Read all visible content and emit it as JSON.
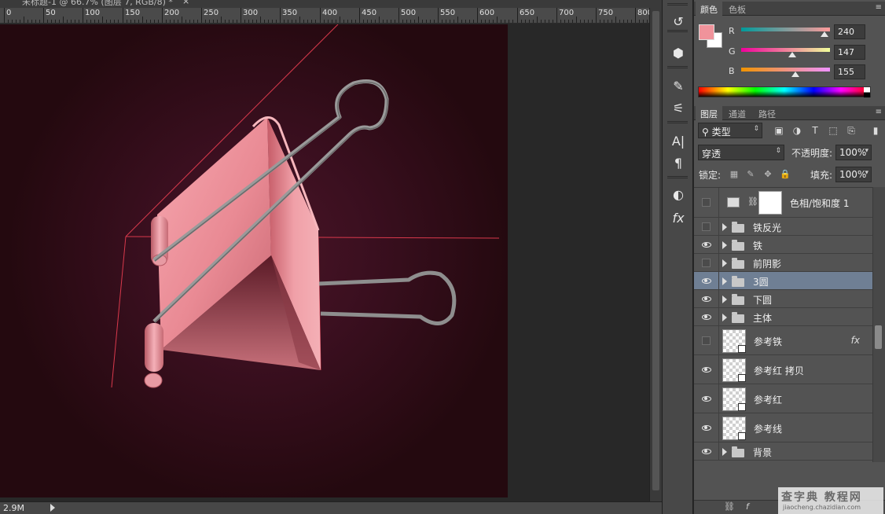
{
  "document": {
    "tab_title": "未标题-1 @ 66.7% (图层 7, RGB/8) *",
    "tab_close": "×",
    "doc_size": "2.9M",
    "ruler_labels": [
      "0",
      "50",
      "100",
      "150",
      "200",
      "250",
      "300",
      "350",
      "400",
      "450",
      "500",
      "550",
      "600",
      "650",
      "700",
      "750",
      "800"
    ]
  },
  "colors": {
    "foreground": "#f0939b",
    "canvas_bg": "#2a0a16",
    "clip_pink": "#f4a0a8",
    "guide_line": "#e0374a",
    "selection": "#6f7f94"
  },
  "color_panel": {
    "tabs": [
      "颜色",
      "色板"
    ],
    "channels": [
      {
        "label": "R",
        "value": "240",
        "fraction": 0.941
      },
      {
        "label": "G",
        "value": "147",
        "fraction": 0.576
      },
      {
        "label": "B",
        "value": "155",
        "fraction": 0.608
      }
    ]
  },
  "layers_panel": {
    "tabs": [
      "图层",
      "通道",
      "路径"
    ],
    "filter_kind": "类型",
    "blend_mode": "穿透",
    "opacity_label": "不透明度:",
    "opacity_value": "100%",
    "lock_label": "锁定:",
    "fill_label": "填充:",
    "fill_value": "100%",
    "layers": [
      {
        "name": "色相/饱和度 1",
        "type": "adjustment",
        "visible": false
      },
      {
        "name": "铁反光",
        "type": "group",
        "visible": false
      },
      {
        "name": "铁",
        "type": "group",
        "visible": true
      },
      {
        "name": "前阴影",
        "type": "group",
        "visible": false
      },
      {
        "name": "3圆",
        "type": "group",
        "visible": true,
        "selected": true
      },
      {
        "name": "下圆",
        "type": "group",
        "visible": true
      },
      {
        "name": "主体",
        "type": "group",
        "visible": true
      },
      {
        "name": "参考铁",
        "type": "smart",
        "visible": false,
        "fx": "fx"
      },
      {
        "name": "参考红 拷贝",
        "type": "smart",
        "visible": true
      },
      {
        "name": "参考红",
        "type": "smart",
        "visible": true
      },
      {
        "name": "参考线",
        "type": "smart",
        "visible": true
      },
      {
        "name": "背景",
        "type": "group",
        "visible": true
      }
    ]
  },
  "toolbar_icons": [
    "history-icon",
    "3d-icon",
    "brush-presets-icon",
    "tool-presets-icon",
    "character-icon",
    "paragraph-icon",
    "adjustments-icon",
    "styles-icon"
  ],
  "tool_glyphs": [
    "↺",
    "⬢",
    "✎",
    "⚟",
    "A|",
    "¶",
    "◐",
    "fx"
  ],
  "watermark": {
    "main": "查字典 教程网",
    "sub": "jiaocheng.chazidian.com"
  }
}
